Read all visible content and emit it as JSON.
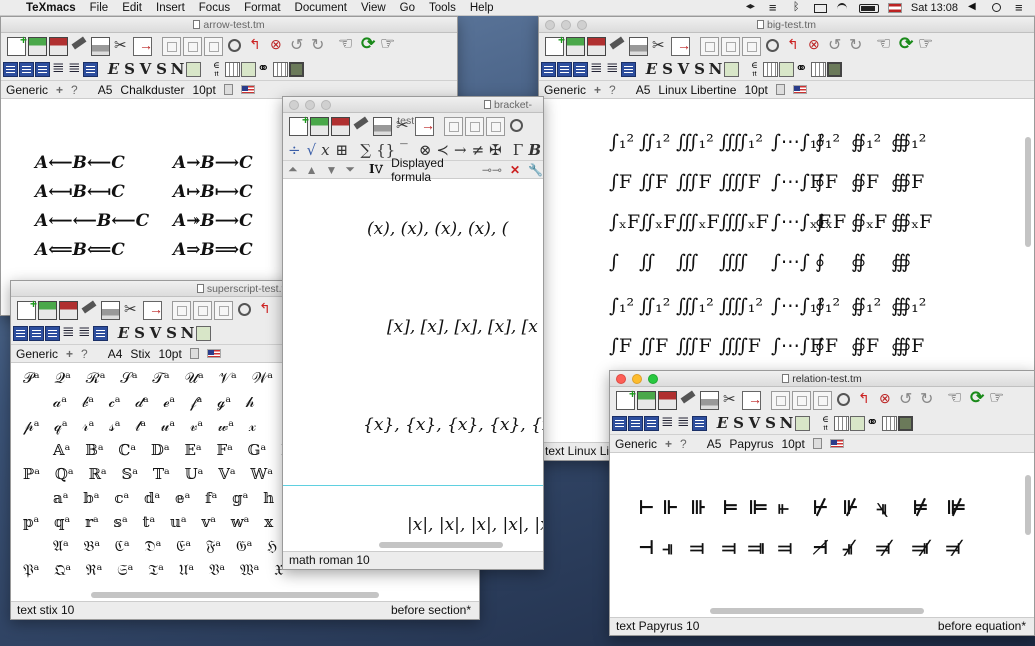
{
  "menubar": {
    "app_name": "TeXmacs",
    "items": [
      "File",
      "Edit",
      "Insert",
      "Focus",
      "Format",
      "Document",
      "View",
      "Go",
      "Tools",
      "Help"
    ],
    "clock": "Sat 13:08"
  },
  "windows": {
    "arrow": {
      "title": "arrow-test.tm",
      "status": {
        "style": "Generic",
        "paper": "A5",
        "font": "Chalkduster",
        "size": "10pt"
      },
      "rows": [
        [
          "A⟵B⟵C",
          "A→B⟶C"
        ],
        [
          "A⟻B⟻C",
          "A↦B⟼C"
        ],
        [
          "A⟵⟵B⟵C",
          "A↠B⟶C"
        ],
        [
          "A⟸B⟸C",
          "A⇒B⟹C"
        ]
      ]
    },
    "superscript": {
      "title": "superscript-test.tm",
      "status": {
        "style": "Generic",
        "paper": "A4",
        "font": "Stix",
        "size": "10pt"
      },
      "rows": [
        "𝒫ᵃ 𝒬ᵃ ℛᵃ 𝒮ᵃ 𝒯ᵃ 𝒰ᵃ 𝒱ᵃ 𝒲ᵃ 𝒳",
        "𝒶ᵃ 𝒷ᵃ 𝒸ᵃ 𝒹ᵃ ℯᵃ 𝒻ᵃ ℊᵃ 𝒽",
        "𝓅ᵃ 𝓆ᵃ 𝓇ᵃ 𝓈ᵃ 𝓉ᵃ 𝓊ᵃ 𝓋ᵃ 𝓌ᵃ 𝓍",
        "𝔸ᵃ 𝔹ᵃ ℂᵃ 𝔻ᵃ 𝔼ᵃ 𝔽ᵃ 𝔾ᵃ ℍ",
        "ℙᵃ ℚᵃ ℝᵃ 𝕊ᵃ 𝕋ᵃ 𝕌ᵃ 𝕍ᵃ 𝕎ᵃ 𝕏",
        "𝕒ᵃ 𝕓ᵃ 𝕔ᵃ 𝕕ᵃ 𝕖ᵃ 𝕗ᵃ 𝕘ᵃ 𝕙",
        "𝕡ᵃ 𝕢ᵃ 𝕣ᵃ 𝕤ᵃ 𝕥ᵃ 𝕦ᵃ 𝕧ᵃ 𝕨ᵃ 𝕩",
        "𝔄ᵃ 𝔅ᵃ ℭᵃ 𝔇ᵃ 𝔈ᵃ 𝔉ᵃ 𝔊ᵃ ℌ",
        "𝔓ᵃ 𝔔ᵃ ℜᵃ 𝔖ᵃ 𝔗ᵃ 𝔘ᵃ 𝔙ᵃ 𝔚ᵃ 𝔛"
      ],
      "footer_left": "text stix 10",
      "footer_right": "before section*"
    },
    "bracket": {
      "title": "bracket-test.tm",
      "context_label": "Displayed formula",
      "lines": [
        "(x), (x), (x), (x), (",
        "[x], [x], [x], [x], [x",
        "{x}, {x}, {x}, {x}, {x",
        "|x|, |x|, |x|, |x|, |x|, |x|, |x|, |x"
      ],
      "footer_left": "math roman 10"
    },
    "big": {
      "title": "big-test.tm",
      "status": {
        "style": "Generic",
        "paper": "A5",
        "font": "Linux Libertine",
        "size": "10pt"
      },
      "rows": [
        [
          "∫₁²",
          "∬₁²",
          "∭₁²",
          "⨌₁²",
          "∫⋯∫₁²",
          "∮₁²",
          "∯₁²",
          "∰₁²"
        ],
        [
          "∫F",
          "∬F",
          "∭F",
          "⨌F",
          "∫⋯∫F",
          "∮F",
          "∯F",
          "∰F"
        ],
        [
          "∫ₓF",
          "∬ₓF",
          "∭ₓF",
          "⨌ₓF",
          "∫⋯∫ₓF",
          "∮ₓF",
          "∯ₓF",
          "∰ₓF"
        ],
        [
          "∫",
          "∬",
          "∭",
          "⨌",
          "∫⋯∫",
          "∮",
          "∯",
          "∰"
        ],
        [
          "∫₁²",
          "∬₁²",
          "∭₁²",
          "⨌₁²",
          "∫⋯∫₁²",
          "∮₁²",
          "∯₁²",
          "∰₁²"
        ],
        [
          "∫F",
          "∬F",
          "∭F",
          "⨌F",
          "∫⋯∫F",
          "∮F",
          "∯F",
          "∰F"
        ]
      ],
      "footer_left": "text Linux Libe"
    },
    "relation": {
      "title": "relation-test.tm",
      "status": {
        "style": "Generic",
        "paper": "A5",
        "font": "Papyrus",
        "size": "10pt"
      },
      "rows": [
        [
          "⊢",
          "⊩",
          "⊪",
          "⊨",
          "⊫",
          "⫦",
          "⊬",
          "⊮",
          "⫣⃥",
          "⊭",
          "⊯"
        ],
        [
          "⊣",
          "⫣",
          "⫤",
          "⫤",
          "⫥",
          "⫤",
          "⊣̸",
          "⫣̸",
          "⫤̸",
          "⫥̸",
          "⫤̸"
        ]
      ],
      "footer_left": "text Papyrus 10",
      "footer_right": "before equation*"
    }
  }
}
